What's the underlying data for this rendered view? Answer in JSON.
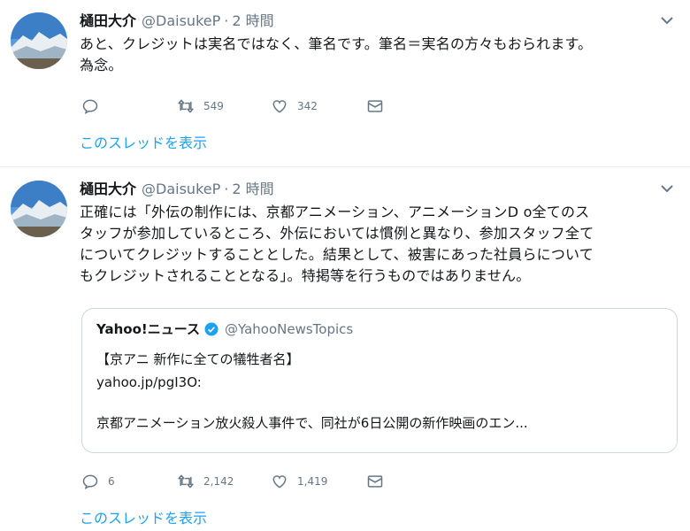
{
  "tweets": [
    {
      "user": {
        "name": "樋田大介",
        "handle": "@DaisukeP",
        "time": "2 時間"
      },
      "separator": "·",
      "text_lines": [
        "あと、クレジットは実名ではなく、筆名です。筆名＝実名の方々もおられます。",
        "為念。"
      ],
      "actions": {
        "replies": "",
        "retweets": "549",
        "likes": "342"
      },
      "thread_link": "このスレッドを表示"
    },
    {
      "user": {
        "name": "樋田大介",
        "handle": "@DaisukeP",
        "time": "2 時間"
      },
      "separator": "·",
      "text_lines": [
        "正確には「外伝の制作には、京都アニメーション、アニメーションD o全てのス",
        "タッフが参加しているところ、外伝においては慣例と異なり、参加スタッフ全て",
        "についてクレジットすることとした。結果として、被害にあった社員らについて",
        "もクレジットされることとなる」。特掲等を行うものではありません。"
      ],
      "quote": {
        "name": "Yahoo!ニュース",
        "handle": "@YahooNewsTopics",
        "line1": "【京アニ 新作に全ての犠牲者名】",
        "line2": "yahoo.jp/pgI3O:",
        "line3": "京都アニメーション放火殺人事件で、同社が6日公開の新作映画のエン..."
      },
      "actions": {
        "replies": "6",
        "retweets": "2,142",
        "likes": "1,419"
      },
      "thread_link": "このスレッドを表示"
    }
  ],
  "colors": {
    "link": "#1da1f2",
    "muted": "#657786",
    "verified": "#1da1f2"
  },
  "icons": [
    "reply-icon",
    "retweet-icon",
    "like-icon",
    "message-icon",
    "chevron-down-icon",
    "verified-icon"
  ]
}
